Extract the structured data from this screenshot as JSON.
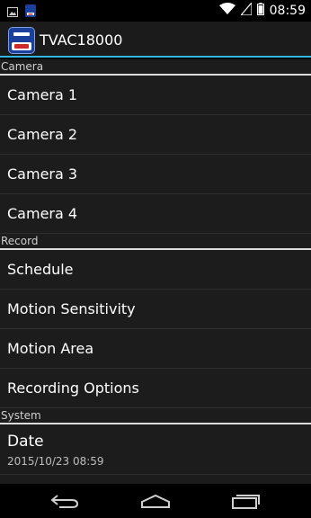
{
  "status_bar": {
    "time": "08:59",
    "icons": [
      "image-notification-icon",
      "app-notification-icon",
      "wifi-icon",
      "signal-icon",
      "battery-icon"
    ]
  },
  "action_bar": {
    "title": "TVAC18000",
    "icon": "abus-app-icon"
  },
  "sections": {
    "camera": {
      "header": "Camera",
      "items": [
        "Camera 1",
        "Camera 2",
        "Camera 3",
        "Camera 4"
      ]
    },
    "record": {
      "header": "Record",
      "items": [
        "Schedule",
        "Motion Sensitivity",
        "Motion Area",
        "Recording Options"
      ]
    },
    "system": {
      "header": "System",
      "date": {
        "title": "Date",
        "summary": "2015/10/23 08:59"
      }
    }
  },
  "nav_bar": {
    "icons": [
      "back-icon",
      "home-icon",
      "recent-apps-icon"
    ]
  },
  "colors": {
    "accent": "#33b5e5",
    "background": "#1c1c1c"
  }
}
